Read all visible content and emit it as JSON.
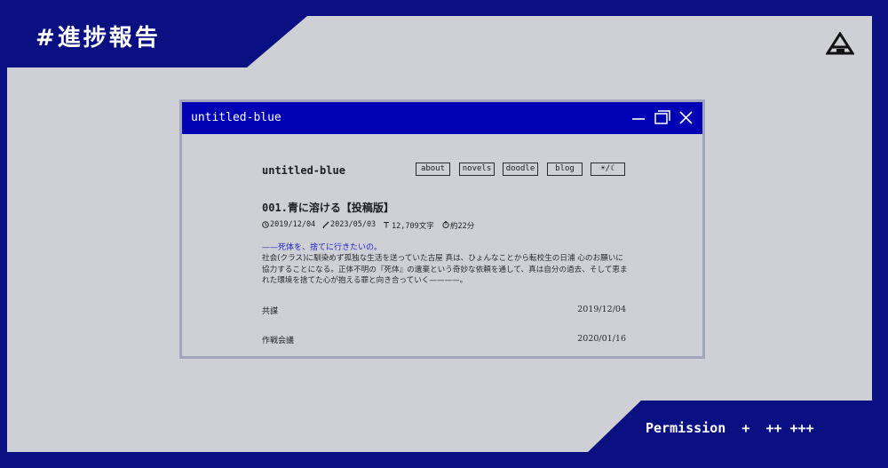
{
  "colors": {
    "navy": "#0a0f82",
    "panel": "#cfd0d6",
    "window_title_blue": "#0000b4",
    "link_blue": "#2323c0"
  },
  "header": {
    "tag": "#進捗報告",
    "logo_icon": "triangle-a-logo-icon"
  },
  "footer": {
    "permission": "Permission  +  ++ +++"
  },
  "window": {
    "title": "untitled-blue",
    "controls": [
      "minimize-icon",
      "maximize-icon",
      "close-icon"
    ]
  },
  "site": {
    "name": "untitled-blue",
    "nav": {
      "about": "about",
      "novels": "novels",
      "doodle": "doodle",
      "blog": "blog",
      "theme": "☀/☾"
    }
  },
  "post": {
    "title": "001.青に溶ける【投稿版】",
    "published": "2019/12/04",
    "updated": "2023/05/03",
    "chars": "12,709文字",
    "read_time": "約22分",
    "tagline": "——死体を、捨てに行きたいの。",
    "description": "社会(クラス)に馴染めず孤独な生活を送っていた古屋 真は、ひょんなことから転校生の日浦 心のお願いに協力することになる。正体不明の『死体』の遺棄という奇妙な依頼を通して、真は自分の過去、そして恵まれた環境を捨てた心が抱える罪と向き合っていく————。"
  },
  "entries": [
    {
      "title": "共謀",
      "date": "2019/12/04"
    },
    {
      "title": "作戦会議",
      "date": "2020/01/16"
    }
  ]
}
